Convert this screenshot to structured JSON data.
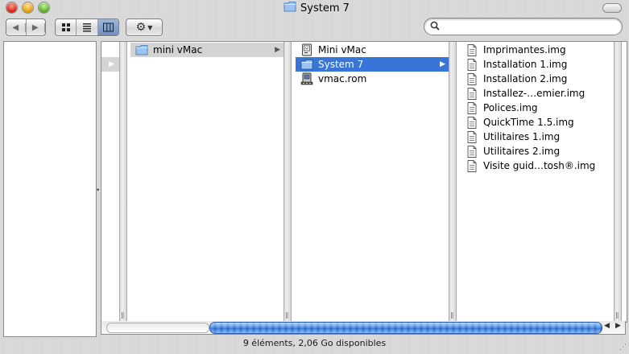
{
  "window": {
    "title": "System 7"
  },
  "toolbar": {
    "back_icon": "back-arrow-icon",
    "forward_icon": "forward-arrow-icon",
    "view_icons": [
      "icon-view-icon",
      "list-view-icon",
      "column-view-icon"
    ],
    "selected_view": "column-view",
    "action_icon": "gear-icon",
    "search": {
      "value": "",
      "placeholder": ""
    }
  },
  "columns": [
    {
      "items": [
        {
          "label": "",
          "has_arrow": true,
          "selected": "grey",
          "icon": "folder-icon"
        }
      ]
    },
    {
      "items": [
        {
          "label": "mini vMac",
          "has_arrow": true,
          "selected": "grey",
          "icon": "folder-icon"
        }
      ]
    },
    {
      "items": [
        {
          "label": "Mini vMac",
          "has_arrow": false,
          "selected": "",
          "icon": "application-icon"
        },
        {
          "label": "System 7",
          "has_arrow": true,
          "selected": "blue",
          "icon": "folder-icon"
        },
        {
          "label": "vmac.rom",
          "has_arrow": false,
          "selected": "",
          "icon": "rom-file-icon"
        }
      ]
    },
    {
      "items": [
        {
          "label": "Imprimantes.img",
          "icon": "disk-image-icon"
        },
        {
          "label": "Installation 1.img",
          "icon": "disk-image-icon"
        },
        {
          "label": "Installation 2.img",
          "icon": "disk-image-icon"
        },
        {
          "label": "Installez-…emier.img",
          "icon": "disk-image-icon"
        },
        {
          "label": "Polices.img",
          "icon": "disk-image-icon"
        },
        {
          "label": "QuickTime 1.5.img",
          "icon": "disk-image-icon"
        },
        {
          "label": "Utilitaires 1.img",
          "icon": "disk-image-icon"
        },
        {
          "label": "Utilitaires 2.img",
          "icon": "disk-image-icon"
        },
        {
          "label": "Visite guid…tosh®.img",
          "icon": "disk-image-icon"
        }
      ]
    }
  ],
  "status": {
    "text": "9 éléments, 2,06 Go disponibles"
  },
  "colors": {
    "selection_blue": "#3875d7",
    "selection_grey": "#d4d4d4",
    "scroll_thumb": "#4b8fe6"
  }
}
